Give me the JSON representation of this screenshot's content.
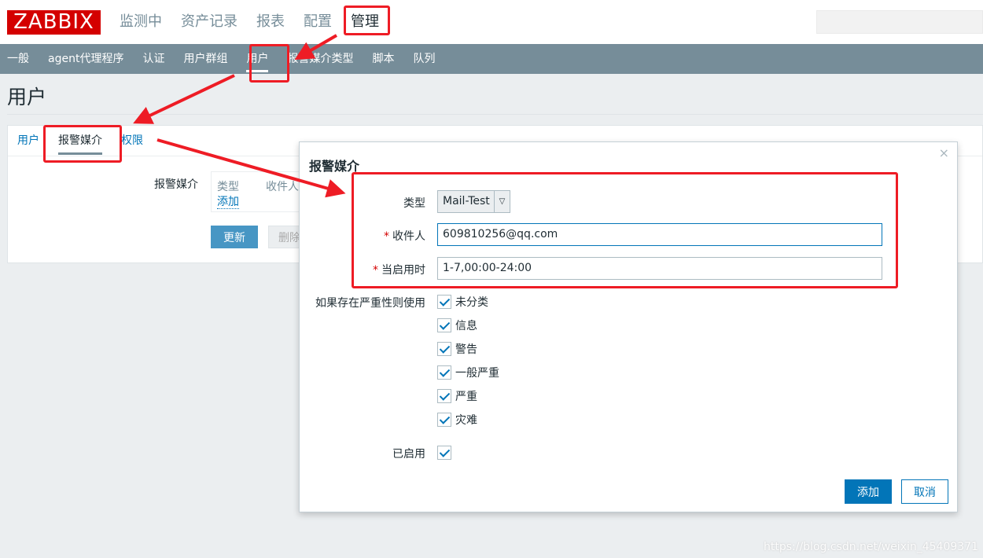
{
  "header": {
    "logo": "ZABBIX",
    "main_nav": [
      "监测中",
      "资产记录",
      "报表",
      "配置",
      "管理"
    ],
    "active_main": "管理"
  },
  "subnav": {
    "items": [
      "一般",
      "agent代理程序",
      "认证",
      "用户群组",
      "用户",
      "报警媒介类型",
      "脚本",
      "队列"
    ],
    "active": "用户"
  },
  "page": {
    "title": "用户",
    "tabs": [
      "用户",
      "报警媒介",
      "权限"
    ],
    "active_tab": "报警媒介",
    "media_label": "报警媒介",
    "media_table": {
      "columns": [
        "类型",
        "收件人"
      ],
      "add_link": "添加"
    },
    "buttons": {
      "update": "更新",
      "delete": "删除"
    }
  },
  "dialog": {
    "title": "报警媒介",
    "close": "×",
    "type_label": "类型",
    "type_value": "Mail-Test",
    "recipient_label": "收件人",
    "recipient_value": "609810256@qq.com",
    "when_active_label": "当启用时",
    "when_active_value": "1-7,00:00-24:00",
    "required_mark": "*",
    "severity_label": "如果存在严重性则使用",
    "severities": [
      {
        "label": "未分类",
        "checked": true
      },
      {
        "label": "信息",
        "checked": true
      },
      {
        "label": "警告",
        "checked": true
      },
      {
        "label": "一般严重",
        "checked": true
      },
      {
        "label": "严重",
        "checked": true
      },
      {
        "label": "灾难",
        "checked": true
      }
    ],
    "enabled_label": "已启用",
    "enabled": true,
    "buttons": {
      "add": "添加",
      "cancel": "取消"
    }
  },
  "watermark": "https://blog.csdn.net/weixin_45409371",
  "colors": {
    "brand": "#d40000",
    "subnav": "#768d99",
    "primary": "#0275b8",
    "annotation": "#ee1c25"
  }
}
